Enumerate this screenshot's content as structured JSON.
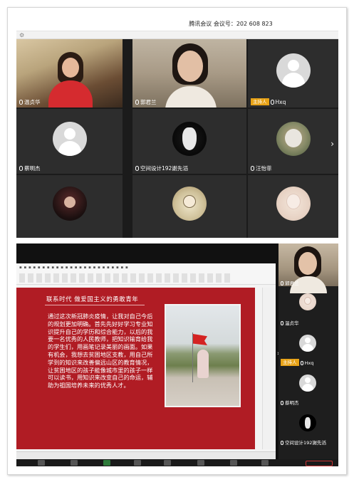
{
  "meeting": {
    "title": "腾讯会议  会议号：202 608 823"
  },
  "grid": {
    "tiles": [
      {
        "name": "温贞华"
      },
      {
        "name": "郭君兰"
      },
      {
        "name": "Hxq",
        "badge": "主持人"
      },
      {
        "name": "蔡明杰"
      },
      {
        "name": "空间设计192謝先滔"
      },
      {
        "name": "汪怡菲"
      },
      {
        "name": ""
      },
      {
        "name": ""
      },
      {
        "name": ""
      }
    ],
    "next_arrow": "›"
  },
  "slide": {
    "title": "联系时代   做爱国主义的勇敢青年",
    "body": "通过这次新冠肺炎疫情，让我对自己今后的规划更加明确。首先先好好学习专业知识提升自己的学历和综合能力，以后的我要一名优秀的人民教师，把知识输育给我的学生们，用画笔记录美丽的画面。如果有机会，我想去贫困地区支教，用自己所学到的知识来改善偏远山区的教育情况，让贫困地区的孩子能像城市里的孩子一样可以读书，用知识来改变自己的命运，辅助为祖国培养未来的优秀人才。"
  },
  "side_panel": {
    "participants": [
      {
        "name": "郭君兰"
      },
      {
        "name": "温贞华"
      },
      {
        "name": "Hxq",
        "badge": "主持人"
      },
      {
        "name": "蔡明杰"
      },
      {
        "name": "空间设计192謝先滔"
      }
    ]
  },
  "colors": {
    "slide_red": "#b01c24",
    "host_badge": "#e8a317",
    "tile_bg": "#2d2d2d"
  }
}
